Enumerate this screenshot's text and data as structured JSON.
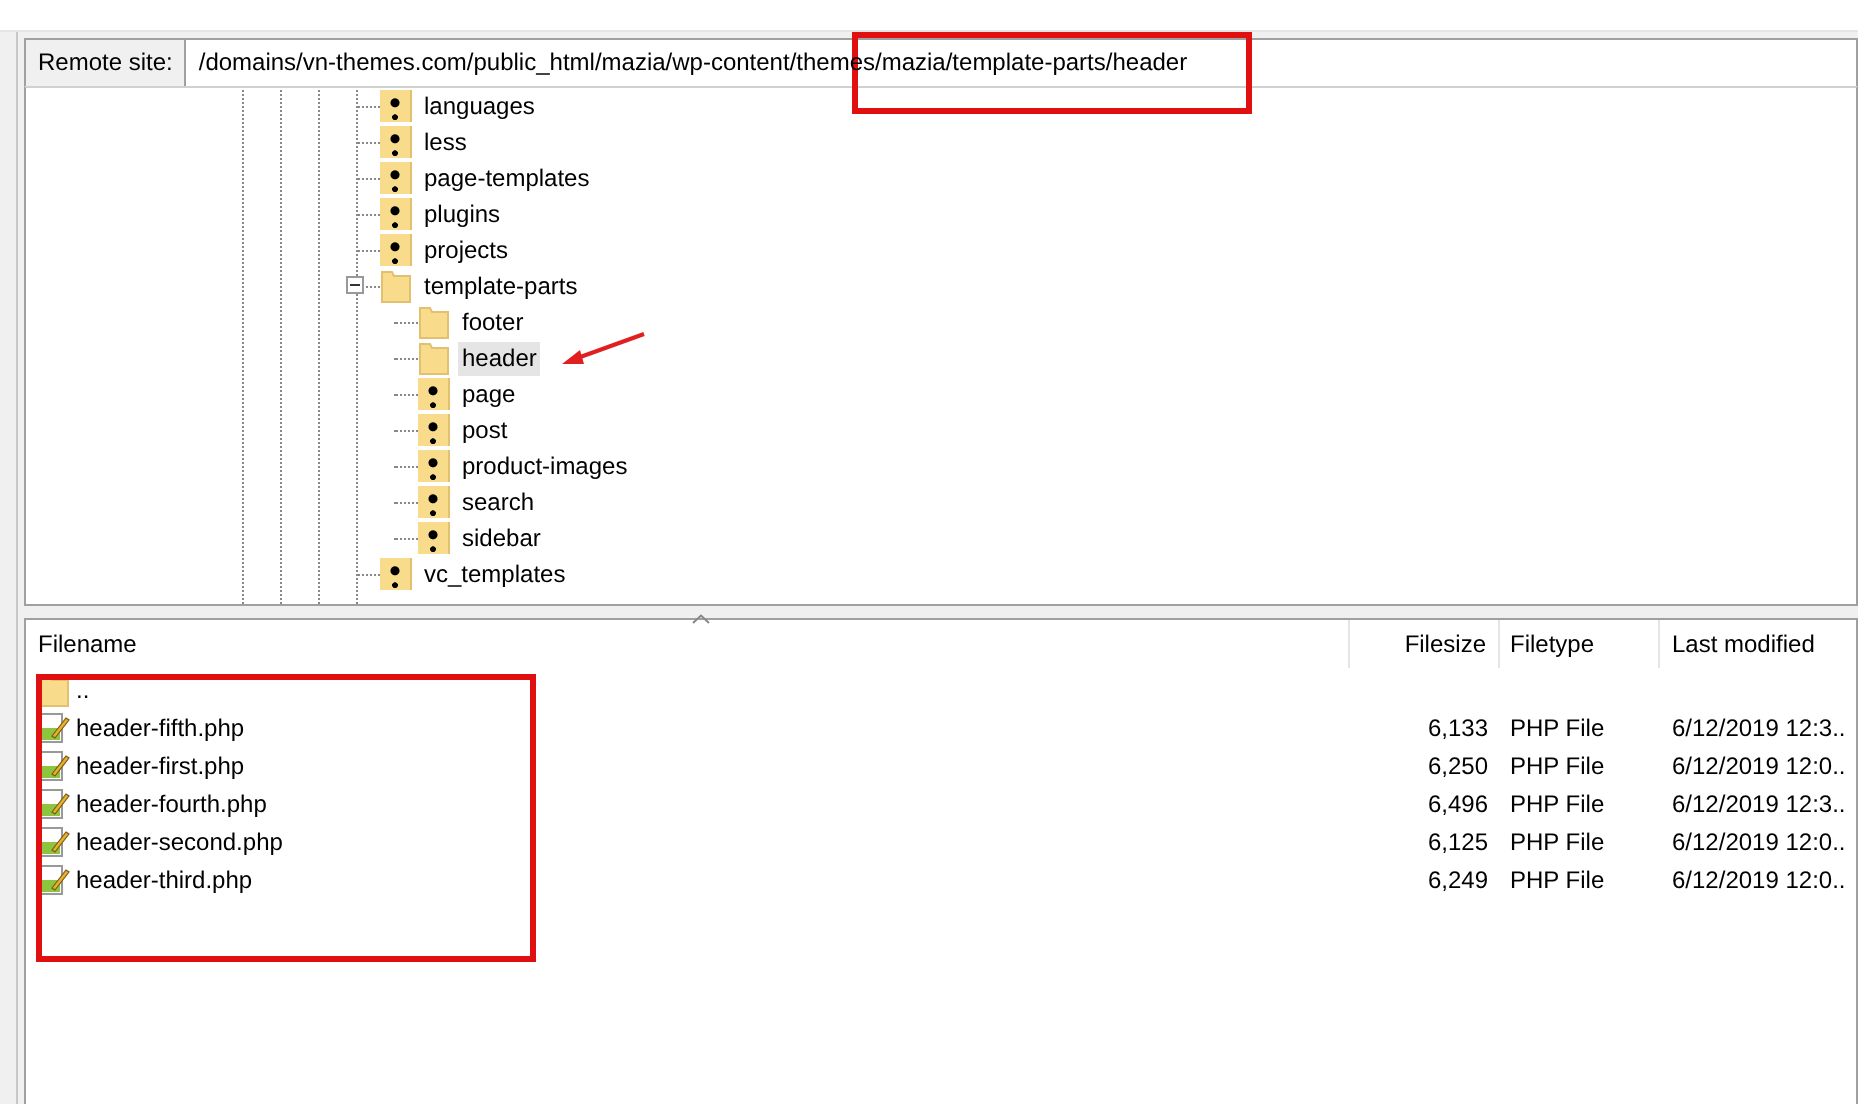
{
  "remote_site": {
    "label": "Remote site:",
    "path": "/domains/vn-themes.com/public_html/mazia/wp-content/themes/mazia/template-parts/header",
    "highlighted": true
  },
  "tree": {
    "items": [
      {
        "label": "languages",
        "kind": "unknown",
        "selected": false
      },
      {
        "label": "less",
        "kind": "unknown",
        "selected": false
      },
      {
        "label": "page-templates",
        "kind": "unknown",
        "selected": false
      },
      {
        "label": "plugins",
        "kind": "unknown",
        "selected": false
      },
      {
        "label": "projects",
        "kind": "unknown",
        "selected": false
      },
      {
        "label": "template-parts",
        "kind": "folder",
        "selected": false,
        "expanded": true,
        "children": [
          {
            "label": "footer",
            "kind": "folder",
            "selected": false
          },
          {
            "label": "header",
            "kind": "folder",
            "selected": true,
            "pointed": true
          },
          {
            "label": "page",
            "kind": "unknown",
            "selected": false
          },
          {
            "label": "post",
            "kind": "unknown",
            "selected": false
          },
          {
            "label": "product-images",
            "kind": "unknown",
            "selected": false
          },
          {
            "label": "search",
            "kind": "unknown",
            "selected": false
          },
          {
            "label": "sidebar",
            "kind": "unknown",
            "selected": false
          }
        ]
      },
      {
        "label": "vc_templates",
        "kind": "unknown",
        "selected": false
      }
    ]
  },
  "file_list": {
    "columns": [
      "Filename",
      "Filesize",
      "Filetype",
      "Last modified"
    ],
    "highlighted": true,
    "rows": [
      {
        "kind": "parent",
        "name": ".."
      },
      {
        "kind": "file",
        "name": "header-fifth.php",
        "size": "6,133",
        "type": "PHP File",
        "modified": "6/12/2019 12:3.."
      },
      {
        "kind": "file",
        "name": "header-first.php",
        "size": "6,250",
        "type": "PHP File",
        "modified": "6/12/2019 12:0.."
      },
      {
        "kind": "file",
        "name": "header-fourth.php",
        "size": "6,496",
        "type": "PHP File",
        "modified": "6/12/2019 12:3.."
      },
      {
        "kind": "file",
        "name": "header-second.php",
        "size": "6,125",
        "type": "PHP File",
        "modified": "6/12/2019 12:0.."
      },
      {
        "kind": "file",
        "name": "header-third.php",
        "size": "6,249",
        "type": "PHP File",
        "modified": "6/12/2019 12:0.."
      }
    ]
  }
}
